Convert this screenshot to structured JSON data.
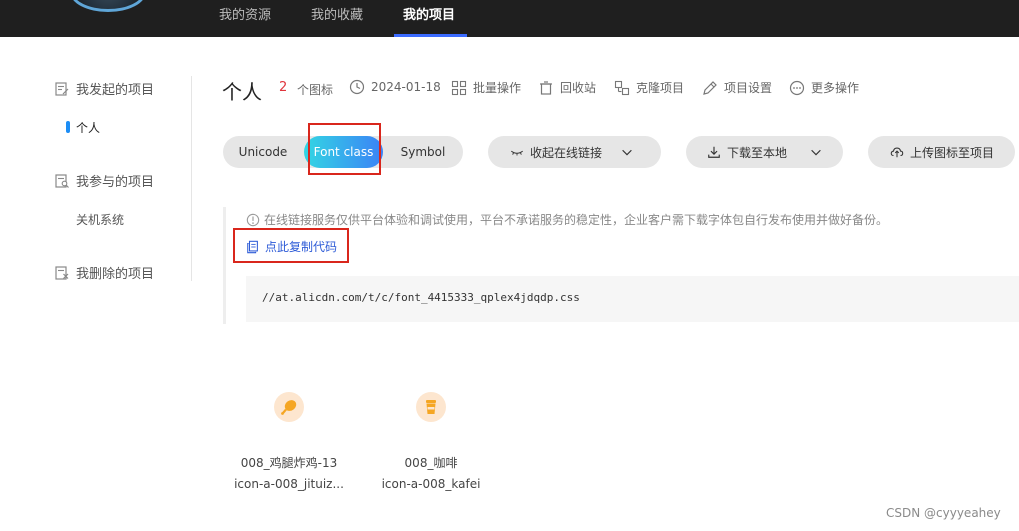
{
  "nav": {
    "items": [
      {
        "label": "我的资源"
      },
      {
        "label": "我的收藏"
      },
      {
        "label": "我的项目"
      }
    ]
  },
  "sidebar": {
    "sections": [
      {
        "label": "我发起的项目",
        "children": [
          {
            "label": "个人"
          }
        ]
      },
      {
        "label": "我参与的项目",
        "children": [
          {
            "label": "关机系统"
          }
        ]
      },
      {
        "label": "我删除的项目",
        "children": []
      }
    ]
  },
  "project": {
    "title": "个人",
    "icon_count": "2",
    "icon_count_label": "个图标",
    "date": "2024-01-18",
    "actions": {
      "batch": "批量操作",
      "recycle": "回收站",
      "clone": "克隆项目",
      "settings": "项目设置",
      "more": "更多操作"
    }
  },
  "tabs": {
    "unicode": "Unicode",
    "font_class": "Font class",
    "symbol": "Symbol",
    "selected": "Font class"
  },
  "buttons": {
    "online_link": "收起在线链接",
    "download": "下载至本地",
    "upload": "上传图标至项目"
  },
  "notice": {
    "text": "在线链接服务仅供平台体验和调试使用，平台不承诺服务的稳定性，企业客户需下载字体包自行发布使用并做好备份。",
    "copy_label": "点此复制代码",
    "code": "//at.alicdn.com/t/c/font_4415333_qplex4jdqdp.css"
  },
  "icons": [
    {
      "name": "008_鸡腿炸鸡-13",
      "class": "icon-a-008_jituiz...",
      "icon": "chicken-leg-icon",
      "color": "#f5a623"
    },
    {
      "name": "008_咖啡",
      "class": "icon-a-008_kafei",
      "icon": "coffee-cup-icon",
      "color": "#f5a623"
    }
  ],
  "colors": {
    "accent": "#2d5bd7",
    "count": "#e0343c",
    "highlight_box": "#d9261c",
    "gradient_start": "#33d6e3",
    "gradient_end": "#3b82f6"
  },
  "watermark": "CSDN @cyyyeahey"
}
